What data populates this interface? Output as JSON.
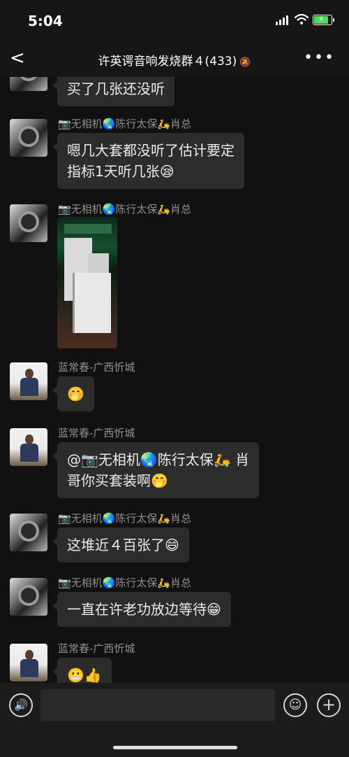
{
  "status": {
    "time": "5:04"
  },
  "nav": {
    "title": "许英谔音响发烧群４(433)",
    "back": "<",
    "more": "•••",
    "mute": "🔕"
  },
  "messages": {
    "m0": {
      "text": "买了几张还没听"
    },
    "m1": {
      "sender": "📷无相机🌏陈行太保🛵肖总",
      "line1": "嗯几大套都没听了估计要定",
      "line2": "指标1天听几张😪"
    },
    "m2": {
      "sender": "📷无相机🌏陈行太保🛵肖总"
    },
    "m3": {
      "sender": "蓝常春-广西忻城",
      "text": "🤭"
    },
    "m4": {
      "sender": "蓝常春-广西忻城",
      "line1": "@📷无相机🌏陈行太保🛵 肖",
      "line2": "哥你买套装啊🤭"
    },
    "m5": {
      "sender": "📷无相机🌏陈行太保🛵肖总",
      "text": "这堆近４百张了😄"
    },
    "m6": {
      "sender": "📷无相机🌏陈行太保🛵肖总",
      "text": "一直在许老功放边等待😁"
    },
    "m7": {
      "sender": "蓝常春-广西忻城",
      "text": "😬👍"
    }
  },
  "input": {
    "voice": "🔊",
    "emoji": "☺",
    "plus": "+"
  }
}
